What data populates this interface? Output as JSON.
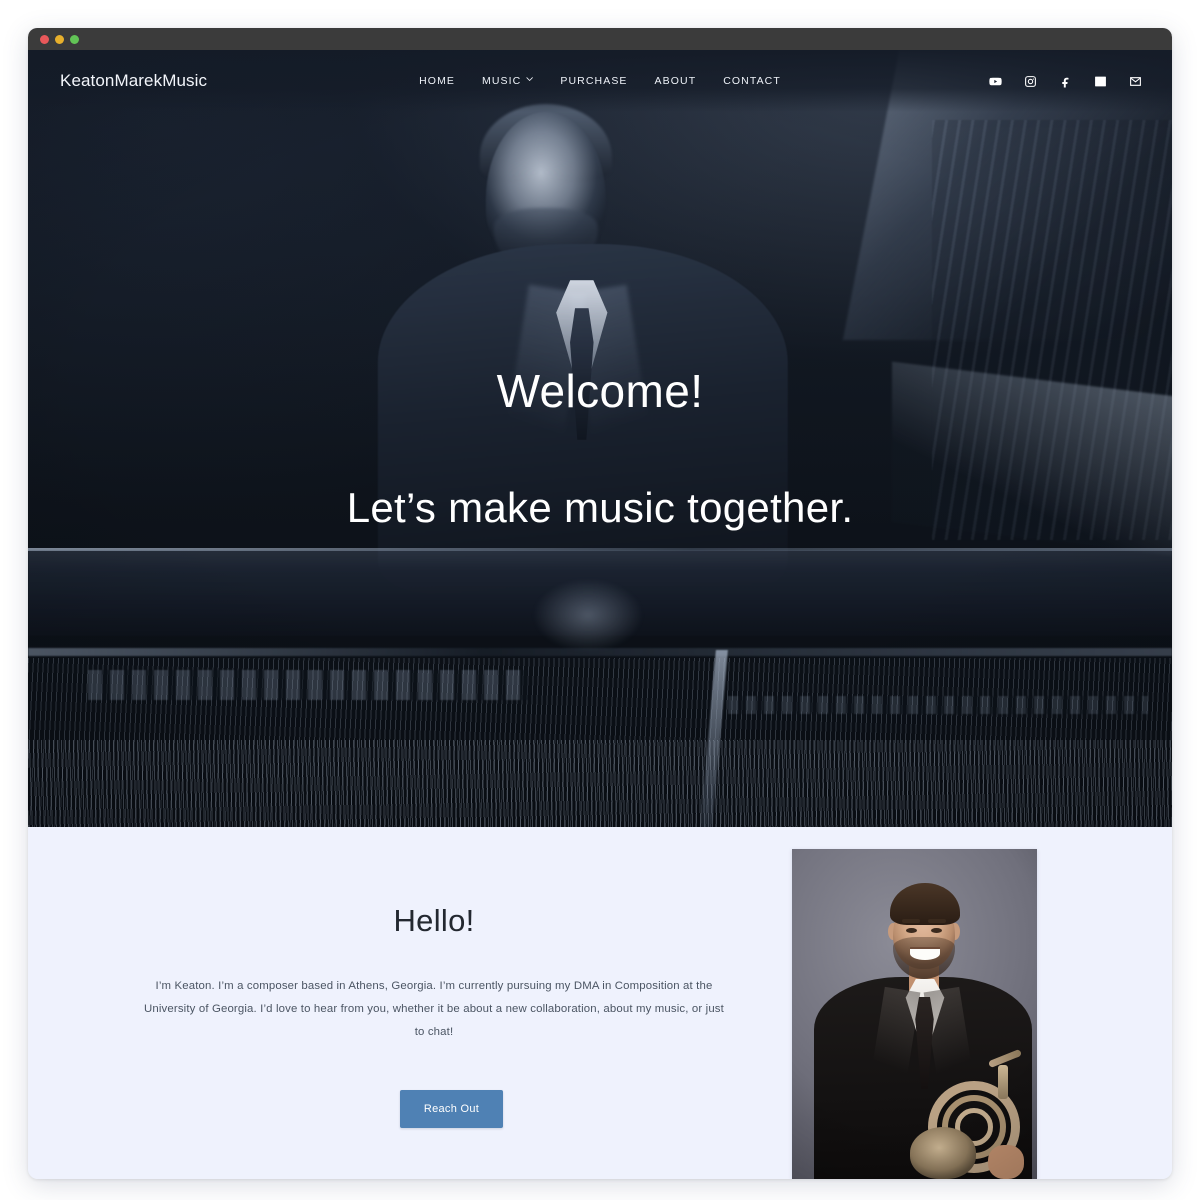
{
  "window": {
    "traffic_lights": [
      "close",
      "minimize",
      "maximize"
    ]
  },
  "header": {
    "logo": "KeatonMarekMusic",
    "nav": [
      {
        "label": "HOME",
        "has_dropdown": false
      },
      {
        "label": "MUSIC",
        "has_dropdown": true
      },
      {
        "label": "PURCHASE",
        "has_dropdown": false
      },
      {
        "label": "ABOUT",
        "has_dropdown": false
      },
      {
        "label": "CONTACT",
        "has_dropdown": false
      }
    ],
    "socials": [
      {
        "name": "youtube-icon"
      },
      {
        "name": "instagram-icon"
      },
      {
        "name": "facebook-icon"
      },
      {
        "name": "linkedin-icon"
      },
      {
        "name": "email-icon"
      }
    ]
  },
  "hero": {
    "title": "Welcome!",
    "subtitle": "Let’s make music together.",
    "image_alt": "Man in a dark suit seated at an open grand piano, blue-toned monochrome photograph"
  },
  "about": {
    "title": "Hello!",
    "body": "I’m Keaton. I’m a composer based in Athens, Georgia. I’m currently pursuing my DMA in Composition at the University of Georgia. I’d love to hear from you, whether it be about a new collaboration, about my music, or just to chat!",
    "cta_label": "Reach Out",
    "portrait_alt": "Smiling man in a black suit and tie holding a french horn, gray studio backdrop"
  },
  "colors": {
    "hero_background": "#141b27",
    "section_background": "#eff2fd",
    "cta_blue": "#4f81b4",
    "nav_text": "#eef2f8",
    "heading_text": "#232830",
    "body_text": "#4b5563",
    "titlebar": "#3b3b3b",
    "dot_red": "#e9585a",
    "dot_yellow": "#e8b02c",
    "dot_green": "#62c456"
  }
}
